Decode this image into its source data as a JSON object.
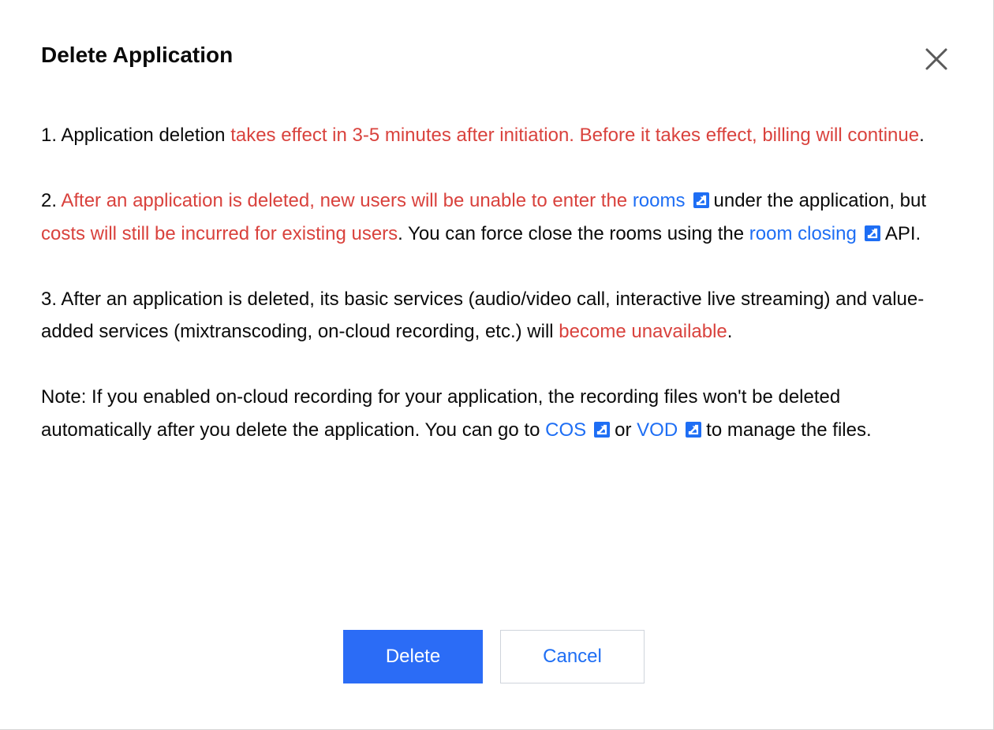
{
  "dialog": {
    "title": "Delete Application",
    "close_icon": "close-icon"
  },
  "colors": {
    "warning": "#d9423d",
    "link": "#1e6ef4",
    "primary_button": "#2b6cf6",
    "text": "#0a0a0a"
  },
  "paragraphs": {
    "p1": {
      "t1": "1. Application deletion ",
      "w1": "takes effect in 3-5 minutes after initiation. Before it takes effect, billing will continue",
      "t2": "."
    },
    "p2": {
      "t1": "2. ",
      "w1": "After an application is deleted, new users will be unable to enter the",
      "sp1": " ",
      "link_rooms": "rooms",
      "t2": "under the application, but ",
      "w2": "costs will still be incurred for existing users",
      "t3": ". You can force close the rooms using the ",
      "link_room_closing": "room closing",
      "t4": "API."
    },
    "p3": {
      "t1": "3. After an application is deleted, its basic services (audio/video call, interactive live streaming) and value-added services (mixtranscoding, on-cloud recording, etc.) will ",
      "w1": "become unavailable",
      "t2": "."
    },
    "note": {
      "t1": "Note: If you enabled on-cloud recording for your application, the recording files won't be deleted automatically after you delete the application. You can go to ",
      "link_cos": "COS",
      "t2": "or ",
      "link_vod": "VOD",
      "t3": "to manage the files."
    },
    "external_link_icon": "external-link-icon"
  },
  "buttons": {
    "delete_label": "Delete",
    "cancel_label": "Cancel"
  }
}
